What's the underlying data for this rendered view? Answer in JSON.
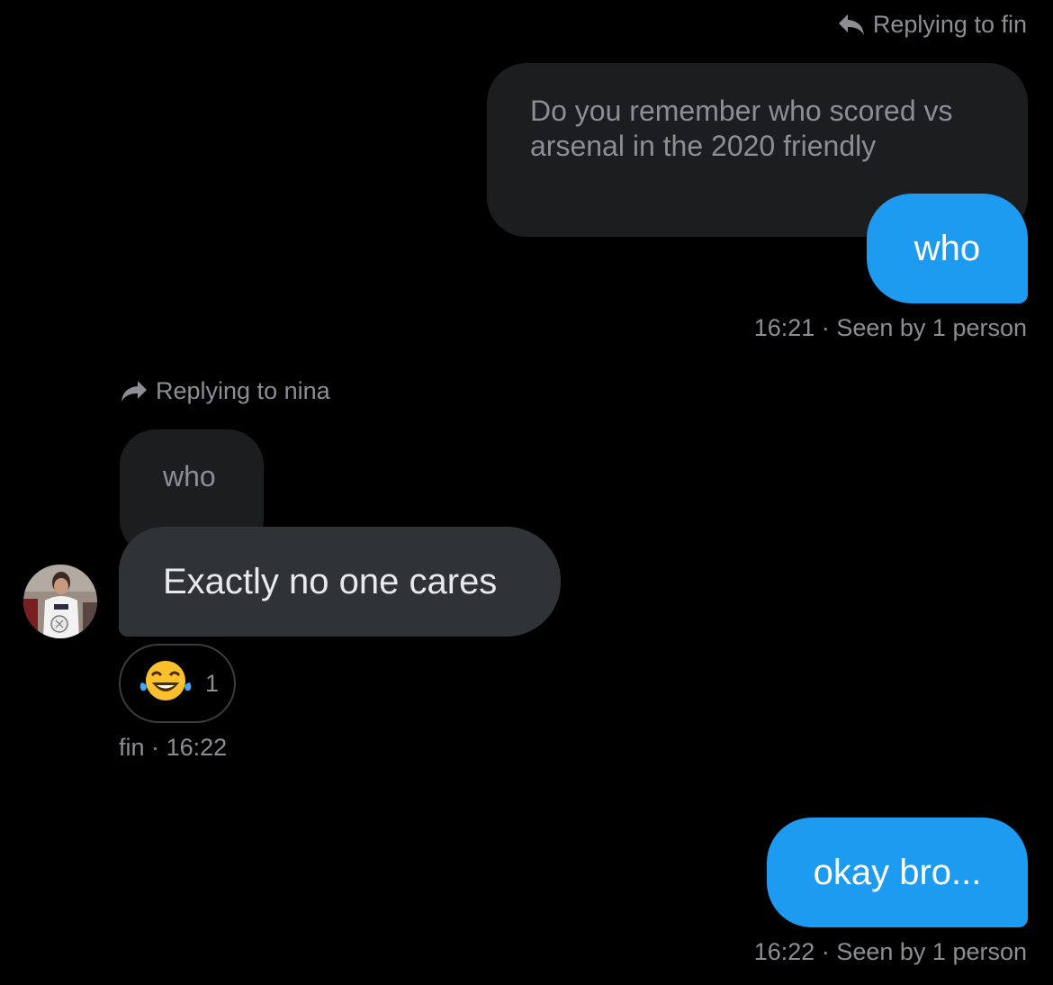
{
  "messages": {
    "first": {
      "reply_label": "Replying to fin",
      "quoted_text": "Do you remember who scored vs arsenal in the 2020 friendly",
      "text": "who",
      "time": "16:21",
      "seen": "Seen by 1 person"
    },
    "second": {
      "reply_label": "Replying to nina",
      "quoted_text": "who",
      "text": "Exactly no one cares",
      "reaction_emoji": "😂",
      "reaction_count": "1",
      "sender": "fin",
      "time": "16:22"
    },
    "third": {
      "text": "okay bro...",
      "time": "16:22",
      "seen": "Seen by 1 person"
    }
  },
  "meta_separator": "·",
  "colors": {
    "background": "#000000",
    "sent_bubble": "#1d9bf0",
    "received_bubble": "#2f3336",
    "quoted_bubble": "#1c1d1f",
    "secondary_text": "#8b8f94"
  },
  "icons": {
    "reply_left": "reply-arrow-icon",
    "reply_right": "forward-arrow-icon"
  }
}
